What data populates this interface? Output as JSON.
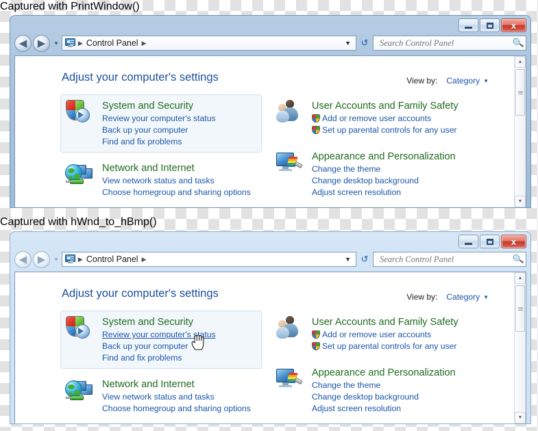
{
  "captions": {
    "first": "Captured with PrintWindow()",
    "second": "Captured with hWnd_to_hBmp()"
  },
  "window": {
    "titlebar": {
      "minimize_label": "",
      "maximize_label": "",
      "close_label": "x",
      "minimize_name": "Minimize",
      "maximize_name": "Maximize",
      "close_name": "Close"
    },
    "navigation": {
      "back_glyph": "◀",
      "forward_glyph": "▶",
      "history_glyph": "▼",
      "refresh_glyph": "↺"
    },
    "address": {
      "icon": "control-panel-icon",
      "crumb": "Control Panel",
      "separator": "▶",
      "dropdown_glyph": "▼"
    },
    "search": {
      "placeholder": "Search Control Panel",
      "value": "",
      "icon": "search-icon"
    }
  },
  "content": {
    "page_title": "Adjust your computer's settings",
    "view_by": {
      "label": "View by:",
      "value": "Category",
      "chevron": "▼"
    },
    "categories": [
      {
        "icon": "security-shield-icon",
        "title": "System and Security",
        "links": [
          {
            "label": "Review your computer's status",
            "shield": false,
            "hover": false
          },
          {
            "label": "Back up your computer",
            "shield": false,
            "hover": false
          },
          {
            "label": "Find and fix problems",
            "shield": false,
            "hover": false
          }
        ]
      },
      {
        "icon": "network-globe-icon",
        "title": "Network and Internet",
        "links": [
          {
            "label": "View network status and tasks",
            "shield": false,
            "hover": false
          },
          {
            "label": "Choose homegroup and sharing options",
            "shield": false,
            "hover": false
          }
        ]
      },
      {
        "icon": "user-accounts-icon",
        "title": "User Accounts and Family Safety",
        "links": [
          {
            "label": "Add or remove user accounts",
            "shield": true,
            "hover": false
          },
          {
            "label": "Set up parental controls for any user",
            "shield": true,
            "hover": false
          }
        ]
      },
      {
        "icon": "appearance-icon",
        "title": "Appearance and Personalization",
        "links": [
          {
            "label": "Change the theme",
            "shield": false,
            "hover": false
          },
          {
            "label": "Change desktop background",
            "shield": false,
            "hover": false
          },
          {
            "label": "Adjust screen resolution",
            "shield": false,
            "hover": false
          }
        ]
      }
    ],
    "scrollbar": {
      "up_glyph": "▲",
      "down_glyph": "▼"
    }
  },
  "colors": {
    "title_link": "#1f6b20",
    "link": "#1b55a8",
    "page_title": "#1c4f9c",
    "highlight_bg": "#f2f7fb",
    "close_button": "#c4382b"
  },
  "second_window_state": {
    "hover_link": "Review your computer's status",
    "cursor": "hand-cursor"
  }
}
